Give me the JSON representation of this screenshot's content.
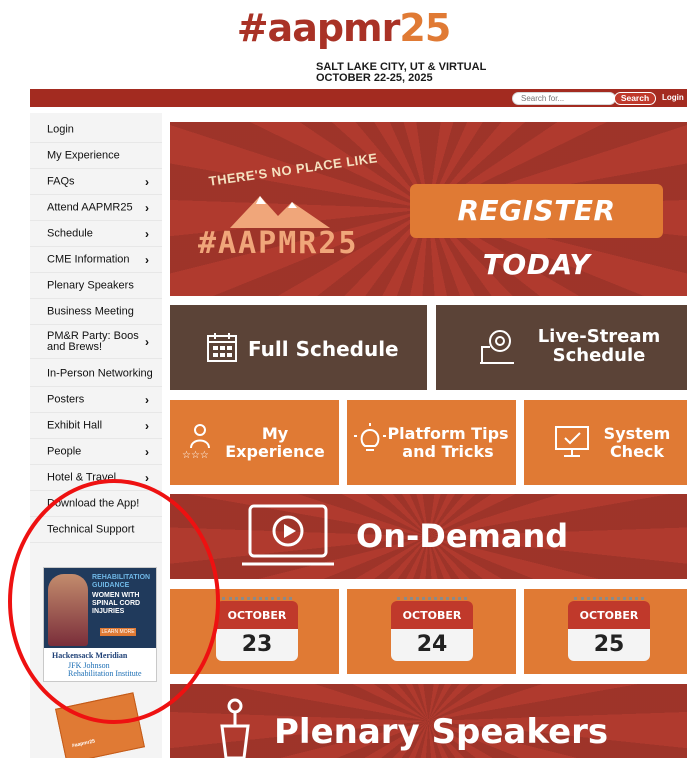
{
  "header": {
    "brand_hash": "#aapmr",
    "brand_year": "25",
    "venue_line1": "SALT LAKE CITY, UT & VIRTUAL",
    "venue_line2": "OCTOBER 22-25, 2025"
  },
  "topbar": {
    "search_placeholder": "Search for...",
    "search_button": "Search",
    "login": "Login"
  },
  "sidebar": {
    "items": [
      {
        "label": "Login",
        "chevron": ""
      },
      {
        "label": "My Experience",
        "chevron": ""
      },
      {
        "label": "FAQs",
        "chevron": "›"
      },
      {
        "label": "Attend AAPMR25",
        "chevron": "›"
      },
      {
        "label": "Schedule",
        "chevron": "›"
      },
      {
        "label": "CME Information",
        "chevron": "›"
      },
      {
        "label": "Plenary Speakers",
        "chevron": ""
      },
      {
        "label": "Business Meeting",
        "chevron": ""
      },
      {
        "label": "PM&R Party: Boos and Brews!",
        "chevron": "›"
      },
      {
        "label": "In-Person Networking",
        "chevron": ""
      },
      {
        "label": "Posters",
        "chevron": "›"
      },
      {
        "label": "Exhibit Hall",
        "chevron": "›"
      },
      {
        "label": "People",
        "chevron": "›"
      },
      {
        "label": "Hotel & Travel",
        "chevron": "›"
      },
      {
        "label": "Download the App!",
        "chevron": ""
      },
      {
        "label": "Technical Support",
        "chevron": ""
      }
    ],
    "ad": {
      "title1": "REHABILITATION GUIDANCE",
      "title2": "WOMEN WITH SPINAL CORD INJURIES",
      "button": "LEARN MORE",
      "org1": "Hackensack Meridian",
      "org2": "JFK Johnson Rehabilitation Institute"
    },
    "ad2_text": "#aapmr25"
  },
  "main": {
    "hero": {
      "tagline": "THERE'S NO PLACE LIKE",
      "hashtag": "#AAPMR25",
      "register": "REGISTER TODAY"
    },
    "tiles": {
      "full_schedule": "Full Schedule",
      "livestream_1": "Live-Stream",
      "livestream_2": "Schedule",
      "my_exp_1": "My",
      "my_exp_2": "Experience",
      "platform_1": "Platform Tips",
      "platform_2": "and Tricks",
      "system_1": "System",
      "system_2": "Check",
      "on_demand": "On-Demand",
      "plenary": "Plenary Speakers"
    },
    "days": [
      {
        "month": "OCTOBER",
        "day": "23"
      },
      {
        "month": "OCTOBER",
        "day": "24"
      },
      {
        "month": "OCTOBER",
        "day": "25"
      }
    ]
  },
  "colors": {
    "red": "#b03a2e",
    "brown": "#5b4337",
    "orange": "#e07a34",
    "annotation": "#ee1111"
  },
  "icons": [
    "calendar-icon",
    "webcam-icon",
    "person-stars-icon",
    "lightbulb-icon",
    "monitor-check-icon",
    "video-play-icon",
    "podium-icon"
  ]
}
